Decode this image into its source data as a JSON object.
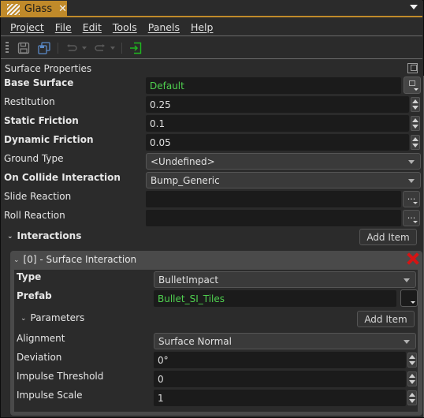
{
  "tab": {
    "title": "Glass",
    "close_glyph": "✕",
    "icon": "glass-texture-icon"
  },
  "menu": [
    "Project",
    "File",
    "Edit",
    "Tools",
    "Panels",
    "Help"
  ],
  "toolbar": {
    "buttons": [
      "save-icon",
      "save-all-icon",
      "undo-icon",
      "redo-icon",
      "exit-icon"
    ]
  },
  "panel": {
    "title": "Surface Properties"
  },
  "properties": {
    "base_surface": {
      "label": "Base Surface",
      "value": "Default"
    },
    "restitution": {
      "label": "Restitution",
      "value": "0.25"
    },
    "static_friction": {
      "label": "Static Friction",
      "value": "0.1"
    },
    "dynamic_friction": {
      "label": "Dynamic Friction",
      "value": "0.05"
    },
    "ground_type": {
      "label": "Ground Type",
      "value": "<Undefined>"
    },
    "on_collide": {
      "label": "On Collide Interaction",
      "value": "Bump_Generic"
    },
    "slide_reaction": {
      "label": "Slide Reaction",
      "value": "",
      "button": "..."
    },
    "roll_reaction": {
      "label": "Roll Reaction",
      "value": "",
      "button": "..."
    }
  },
  "interactions": {
    "label": "Interactions",
    "add_label": "Add Item",
    "items": [
      {
        "title": "[0] - Surface Interaction",
        "type": {
          "label": "Type",
          "value": "BulletImpact"
        },
        "prefab": {
          "label": "Prefab",
          "value": "Bullet_SI_Tiles"
        },
        "parameters": {
          "label": "Parameters",
          "add_label": "Add Item"
        },
        "alignment": {
          "label": "Alignment",
          "value": "Surface Normal"
        },
        "deviation": {
          "label": "Deviation",
          "value": "0°"
        },
        "impulse_threshold": {
          "label": "Impulse Threshold",
          "value": "0"
        },
        "impulse_scale": {
          "label": "Impulse Scale",
          "value": "1"
        }
      }
    ]
  },
  "colors": {
    "accent": "#c08a2a",
    "asset_link": "#4fd04f",
    "delete": "#d41414"
  }
}
